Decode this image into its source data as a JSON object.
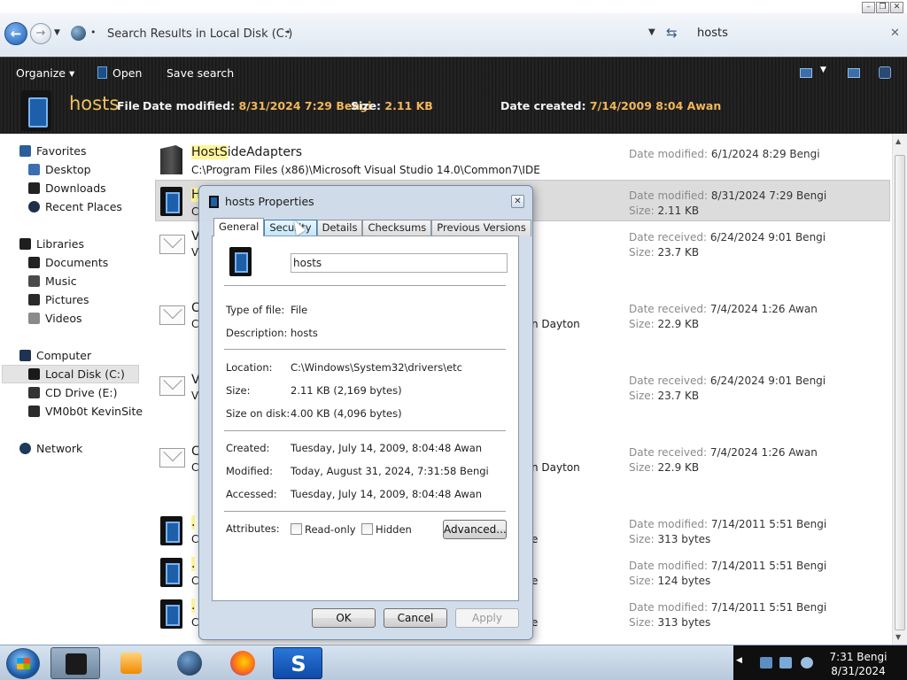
{
  "window": {
    "controls": [
      "minimize",
      "restore",
      "close"
    ]
  },
  "address": {
    "breadcrumb": "Search Results in Local Disk (C:)",
    "search_value": "hosts"
  },
  "toolbar": {
    "organize": "Organize",
    "open": "Open",
    "save_search": "Save search"
  },
  "details_pane": {
    "name": "hosts",
    "type": "File",
    "date_modified_label": "Date modified:",
    "date_modified": "8/31/2024 7:29 Bengi",
    "size_label": "Size:",
    "size": "2.11 KB",
    "date_created_label": "Date created:",
    "date_created": "7/14/2009 8:04 Awan"
  },
  "nav": {
    "favorites": "Favorites",
    "desktop": "Desktop",
    "downloads": "Downloads",
    "recent_places": "Recent Places",
    "libraries": "Libraries",
    "documents": "Documents",
    "music": "Music",
    "pictures": "Pictures",
    "videos": "Videos",
    "computer": "Computer",
    "local_disk": "Local Disk (C:)",
    "cd_drive": "CD Drive (E:)",
    "vm_share": "VM0b0t KevinSite",
    "network": "Network"
  },
  "results": [
    {
      "title_hl": "HostS",
      "title_rest": "ideAdapters",
      "sub": "C:\\Program Files (x86)\\Microsoft Visual Studio 14.0\\Common7\\IDE",
      "m1_label": "Date modified:",
      "m1": "6/1/2024 8:29 Bengi",
      "m2_label": "",
      "m2": ""
    },
    {
      "title_hl": "H",
      "title_rest": "",
      "sub": "C",
      "m1_label": "Date modified:",
      "m1": "8/31/2024 7:29 Bengi",
      "m2_label": "Size:",
      "m2": "2.11 KB"
    },
    {
      "title_hl": "",
      "title_rest": "V",
      "sub": "V",
      "m1_label": "Date received:",
      "m1": "6/24/2024 9:01 Bengi",
      "m2_label": "Size:",
      "m2": "23.7 KB"
    },
    {
      "title_hl": "",
      "title_rest": "C",
      "sub": "C",
      "extra": "n Dayton",
      "m1_label": "Date received:",
      "m1": "7/4/2024 1:26 Awan",
      "m2_label": "Size:",
      "m2": "22.9 KB"
    },
    {
      "title_hl": "",
      "title_rest": "V",
      "sub": "V",
      "m1_label": "Date received:",
      "m1": "6/24/2024 9:01 Bengi",
      "m2_label": "Size:",
      "m2": "23.7 KB"
    },
    {
      "title_hl": "",
      "title_rest": "C",
      "sub": "C",
      "extra": "n Dayton",
      "m1_label": "Date received:",
      "m1": "7/4/2024 1:26 Awan",
      "m2_label": "Size:",
      "m2": "22.9 KB"
    },
    {
      "title_hl": ".",
      "title_rest": "",
      "sub": "C",
      "extra": "e",
      "m1_label": "Date modified:",
      "m1": "7/14/2011 5:51 Bengi",
      "m2_label": "Size:",
      "m2": "313 bytes"
    },
    {
      "title_hl": ".",
      "title_rest": "",
      "sub": "C",
      "extra": "e",
      "m1_label": "Date modified:",
      "m1": "7/14/2011 5:51 Bengi",
      "m2_label": "Size:",
      "m2": "124 bytes"
    },
    {
      "title_hl": ".",
      "title_rest": "",
      "sub": "C",
      "extra": "e",
      "m1_label": "Date modified:",
      "m1": "7/14/2011 5:51 Bengi",
      "m2_label": "Size:",
      "m2": "313 bytes"
    }
  ],
  "dialog": {
    "title": "hosts Properties",
    "tabs": [
      "General",
      "Security",
      "Details",
      "Checksums",
      "Previous Versions"
    ],
    "file_name": "hosts",
    "type_label": "Type of file:",
    "type_value": "File",
    "desc_label": "Description:",
    "desc_value": "hosts",
    "location_label": "Location:",
    "location_value": "C:\\Windows\\System32\\drivers\\etc",
    "size_label": "Size:",
    "size_value": "2.11 KB (2,169 bytes)",
    "size_disk_label": "Size on disk:",
    "size_disk_value": "4.00 KB (4,096 bytes)",
    "created_label": "Created:",
    "created_value": "Tuesday, July 14, 2009, 8:04:48 Awan",
    "modified_label": "Modified:",
    "modified_value": "Today, August 31, 2024, 7:31:58 Bengi",
    "accessed_label": "Accessed:",
    "accessed_value": "Tuesday, July 14, 2009, 8:04:48 Awan",
    "attributes_label": "Attributes:",
    "readonly_label": "Read-only",
    "hidden_label": "Hidden",
    "advanced_label": "Advanced...",
    "ok_label": "OK",
    "cancel_label": "Cancel",
    "apply_label": "Apply"
  },
  "taskbar": {
    "apps": [
      "explorer-icon",
      "media-player-icon",
      "globe-icon",
      "firefox-icon",
      "s-app-icon"
    ],
    "time": "7:31 Bengi",
    "date": "8/31/2024"
  }
}
